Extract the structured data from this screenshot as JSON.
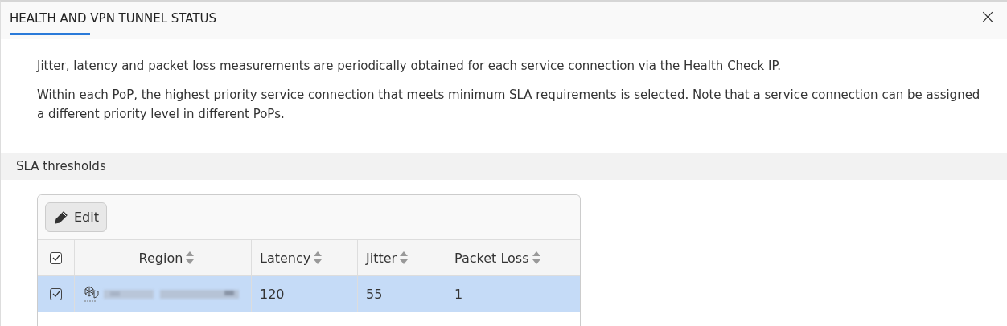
{
  "dialog": {
    "title": "HEALTH AND VPN TUNNEL STATUS",
    "close": "×"
  },
  "paragraphs": [
    "Jitter, latency and packet loss measurements are periodically obtained for each service connection via the Health Check IP.",
    "Within each PoP, the highest priority service connection that meets minimum SLA requirements is selected. Note that a service connection can be assigned a different priority level in different PoPs."
  ],
  "section": {
    "title": "SLA thresholds"
  },
  "table": {
    "toolbar": {
      "edit_label": "Edit"
    },
    "select_all": {
      "checked": true
    },
    "columns": [
      "Region",
      "Latency",
      "Jitter",
      "Packet Loss"
    ],
    "rows": [
      {
        "selected": true,
        "checked": true,
        "cells": [
          "",
          "120",
          "55",
          "1"
        ]
      }
    ]
  }
}
